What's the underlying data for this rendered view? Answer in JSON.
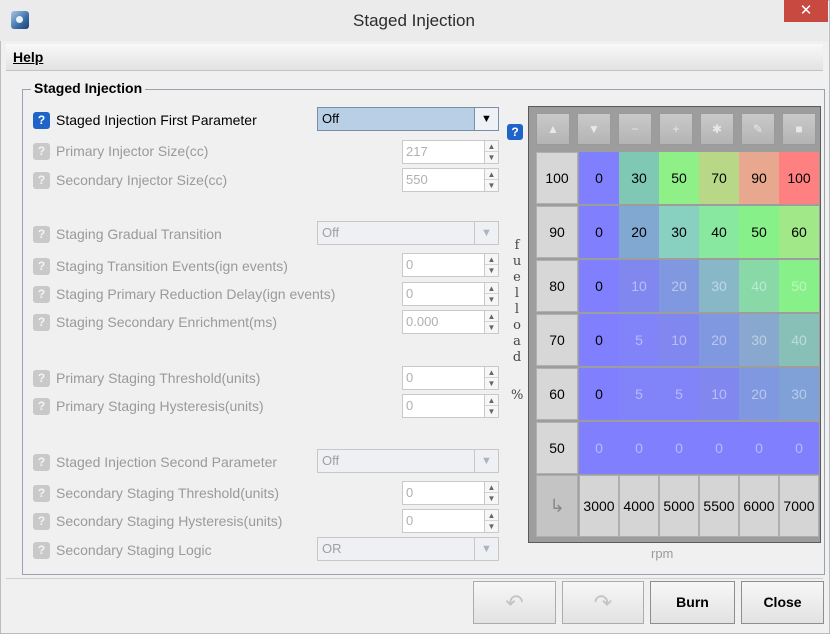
{
  "window": {
    "title": "Staged Injection",
    "close_glyph": "✕"
  },
  "menu": {
    "help": "Help"
  },
  "group": {
    "title": "Staged Injection"
  },
  "fields": {
    "first_parameter": {
      "label": "Staged Injection First Parameter",
      "value": "Off"
    },
    "primary_injector_size": {
      "label": "Primary Injector Size(cc)",
      "value": "217"
    },
    "secondary_injector_size": {
      "label": "Secondary Injector Size(cc)",
      "value": "550"
    },
    "gradual_transition": {
      "label": "Staging Gradual Transition",
      "value": "Off"
    },
    "transition_events": {
      "label": "Staging Transition Events(ign events)",
      "value": "0"
    },
    "primary_reduction_delay": {
      "label": "Staging Primary Reduction Delay(ign events)",
      "value": "0"
    },
    "secondary_enrichment": {
      "label": "Staging Secondary Enrichment(ms)",
      "value": "0.000"
    },
    "primary_threshold": {
      "label": "Primary Staging Threshold(units)",
      "value": "0"
    },
    "primary_hysteresis": {
      "label": "Primary Staging Hysteresis(units)",
      "value": "0"
    },
    "second_parameter": {
      "label": "Staged Injection Second Parameter",
      "value": "Off"
    },
    "secondary_threshold": {
      "label": "Secondary Staging Threshold(units)",
      "value": "0"
    },
    "secondary_hysteresis": {
      "label": "Secondary Staging Hysteresis(units)",
      "value": "0"
    },
    "secondary_logic": {
      "label": "Secondary Staging Logic",
      "value": "OR"
    }
  },
  "axis_labels": {
    "y_letters": [
      "f",
      "u",
      "e",
      "l",
      "l",
      "o",
      "a",
      "d",
      "%"
    ],
    "x": "rpm"
  },
  "table": {
    "toolbar": [
      "▲",
      "▼",
      "−",
      "+",
      "✱",
      "✎",
      "■"
    ],
    "row_headers": [
      "100",
      "90",
      "80",
      "70",
      "60",
      "50"
    ],
    "col_headers": [
      "3000",
      "4000",
      "5000",
      "5500",
      "6000",
      "7000"
    ],
    "values": [
      [
        "0",
        "30",
        "50",
        "70",
        "90",
        "100"
      ],
      [
        "0",
        "20",
        "30",
        "40",
        "50",
        "60"
      ],
      [
        "0",
        "10",
        "20",
        "30",
        "40",
        "50"
      ],
      [
        "0",
        "5",
        "10",
        "20",
        "30",
        "40"
      ],
      [
        "0",
        "5",
        "5",
        "10",
        "20",
        "30"
      ],
      [
        "0",
        "0",
        "0",
        "0",
        "0",
        "0"
      ]
    ],
    "colors": [
      [
        "#8080ff",
        "#7fc8b4",
        "#8ff088",
        "#b8d888",
        "#e8a890",
        "#ff8080"
      ],
      [
        "#8080ff",
        "#80a8d0",
        "#88d0c0",
        "#88e8a0",
        "#88f088",
        "#a0e888"
      ],
      [
        "#8080ff",
        "#8088f0",
        "#8098e0",
        "#88b8c8",
        "#88d8a8",
        "#88f088"
      ],
      [
        "#8080ff",
        "#8084f8",
        "#8088f0",
        "#8098e0",
        "#88a8d0",
        "#88c0b8"
      ],
      [
        "#8080ff",
        "#8084f8",
        "#8084f8",
        "#8088f0",
        "#8098e0",
        "#80a0d8"
      ],
      [
        "#8080ff",
        "#8080ff",
        "#8080ff",
        "#8080ff",
        "#8080ff",
        "#8080ff"
      ]
    ]
  },
  "buttons": {
    "burn": "Burn",
    "close": "Close",
    "undo_glyph": "↶",
    "redo_glyph": "↷"
  }
}
